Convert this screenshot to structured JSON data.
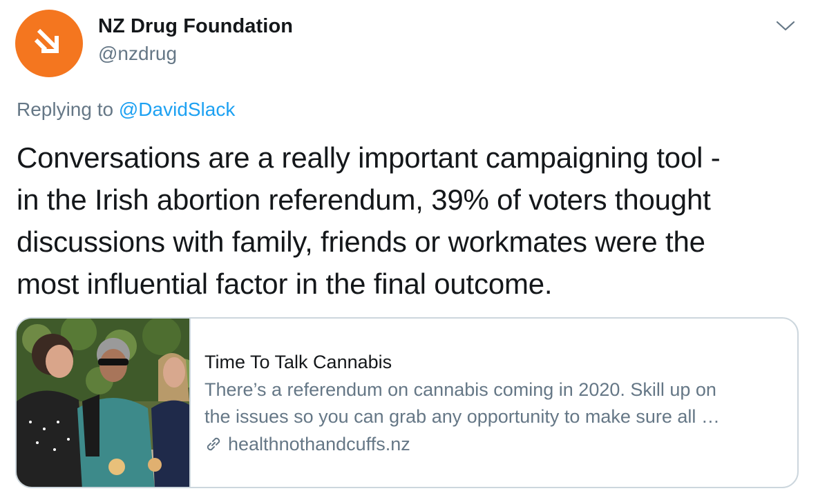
{
  "author": {
    "name": "NZ Drug Foundation",
    "handle": "@nzdrug",
    "avatar_color": "#f4761f",
    "avatar_icon": "arrow-down-right-icon"
  },
  "menu_icon": "chevron-down-icon",
  "reply": {
    "prefix": "Replying to",
    "mention": "@DavidSlack"
  },
  "tweet_text_lines": [
    "Conversations are a really important campaigning tool -",
    "in the Irish abortion referendum, 39% of voters thought",
    "discussions with family, friends or workmates were the",
    "most influential factor in the final outcome."
  ],
  "card": {
    "title": "Time To Talk Cannabis",
    "description_lines": [
      "There’s a referendum on cannabis coming in 2020. Skill up on",
      "the issues so you can grab any opportunity to make sure all …"
    ],
    "domain": "healthnothandcuffs.nz",
    "link_icon": "link-icon"
  },
  "colors": {
    "text": "#14171a",
    "secondary": "#657786",
    "mention": "#1da1f2",
    "border": "#ccd6dd"
  }
}
